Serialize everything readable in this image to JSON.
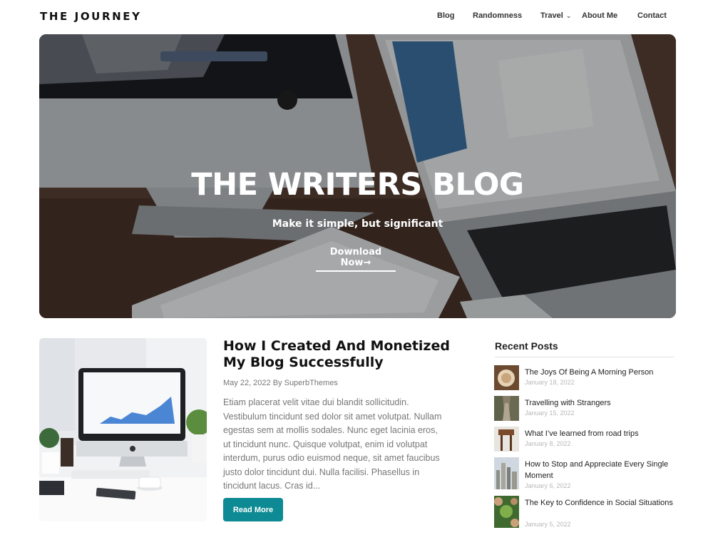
{
  "site": {
    "logo": "THE JOURNEY"
  },
  "nav": {
    "items": [
      {
        "label": "Blog"
      },
      {
        "label": "Randomness"
      },
      {
        "label": "Travel",
        "has_dropdown": true
      },
      {
        "label": "About Me"
      },
      {
        "label": "Contact"
      }
    ]
  },
  "hero": {
    "title": "THE WRITERS BLOG",
    "subtitle": "Make it simple, but significant",
    "cta_label": "Download Now",
    "cta_icon": "arrow-right-icon"
  },
  "post": {
    "title": "How I Created And Monetized My Blog Successfully",
    "meta": "May 22, 2022 By SuperbThemes",
    "excerpt": "Etiam placerat velit vitae dui blandit sollicitudin. Vestibulum tincidunt sed dolor sit amet volutpat. Nullam egestas sem at mollis sodales. Nunc eget lacinia eros, ut tincidunt nunc. Quisque volutpat, enim id volutpat interdum, purus odio euismod neque, sit amet faucibus justo dolor tincidunt dui. Nulla facilisi. Phasellus in tincidunt lacus. Cras id...",
    "read_more": "Read More",
    "button_color": "#0d8a93"
  },
  "sidebar": {
    "title": "Recent Posts",
    "posts": [
      {
        "title": "The Joys Of Being A Morning Person",
        "date": "January 18, 2022"
      },
      {
        "title": "Travelling with Strangers",
        "date": "January 15, 2022"
      },
      {
        "title": "What I’ve learned from road trips",
        "date": "January 8, 2022"
      },
      {
        "title": "How to Stop and Appreciate Every Single Moment",
        "date": "January 6, 2022"
      },
      {
        "title": "The Key to Confidence in Social Situations",
        "date": "January 5, 2022"
      }
    ]
  }
}
